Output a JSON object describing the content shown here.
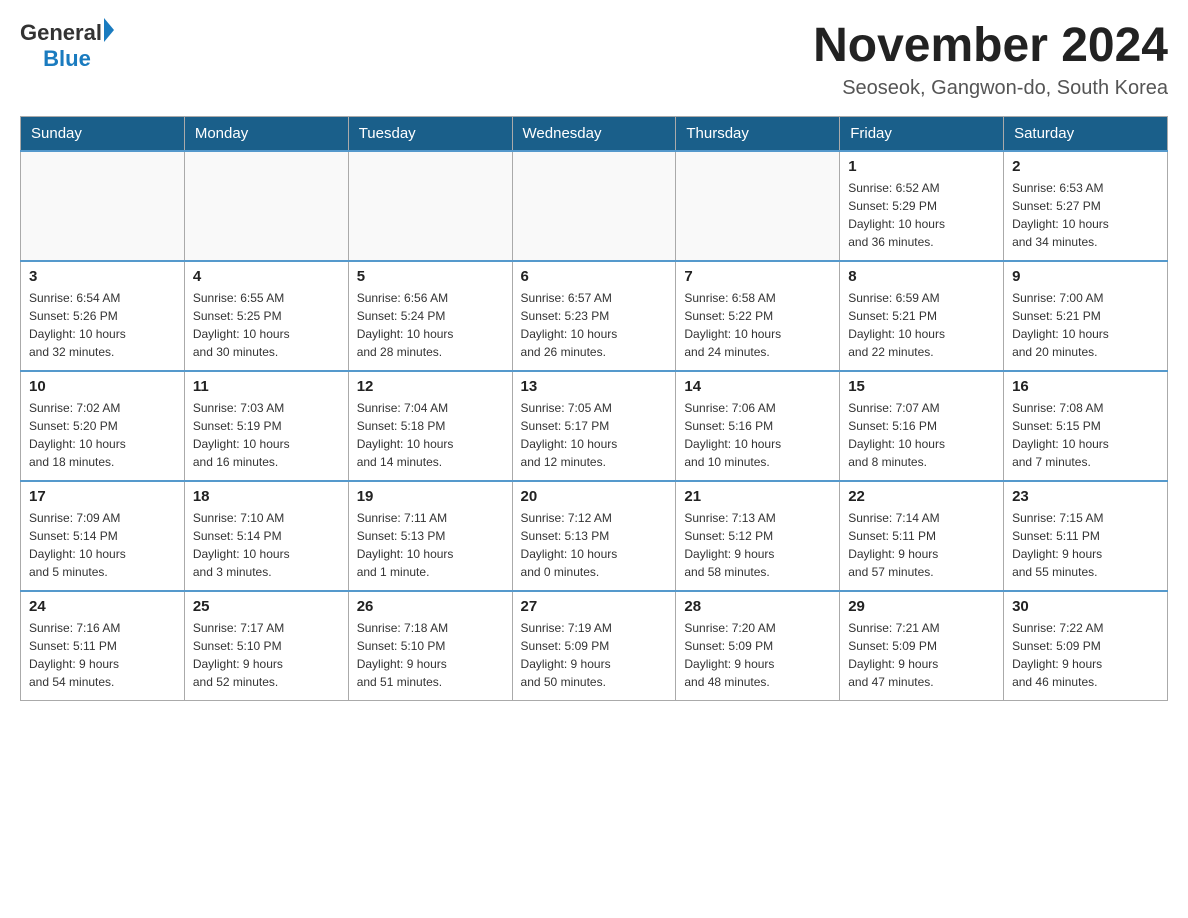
{
  "header": {
    "logo_general": "General",
    "logo_blue": "Blue",
    "month_year": "November 2024",
    "location": "Seoseok, Gangwon-do, South Korea"
  },
  "weekdays": [
    "Sunday",
    "Monday",
    "Tuesday",
    "Wednesday",
    "Thursday",
    "Friday",
    "Saturday"
  ],
  "weeks": [
    [
      {
        "day": "",
        "info": ""
      },
      {
        "day": "",
        "info": ""
      },
      {
        "day": "",
        "info": ""
      },
      {
        "day": "",
        "info": ""
      },
      {
        "day": "",
        "info": ""
      },
      {
        "day": "1",
        "info": "Sunrise: 6:52 AM\nSunset: 5:29 PM\nDaylight: 10 hours\nand 36 minutes."
      },
      {
        "day": "2",
        "info": "Sunrise: 6:53 AM\nSunset: 5:27 PM\nDaylight: 10 hours\nand 34 minutes."
      }
    ],
    [
      {
        "day": "3",
        "info": "Sunrise: 6:54 AM\nSunset: 5:26 PM\nDaylight: 10 hours\nand 32 minutes."
      },
      {
        "day": "4",
        "info": "Sunrise: 6:55 AM\nSunset: 5:25 PM\nDaylight: 10 hours\nand 30 minutes."
      },
      {
        "day": "5",
        "info": "Sunrise: 6:56 AM\nSunset: 5:24 PM\nDaylight: 10 hours\nand 28 minutes."
      },
      {
        "day": "6",
        "info": "Sunrise: 6:57 AM\nSunset: 5:23 PM\nDaylight: 10 hours\nand 26 minutes."
      },
      {
        "day": "7",
        "info": "Sunrise: 6:58 AM\nSunset: 5:22 PM\nDaylight: 10 hours\nand 24 minutes."
      },
      {
        "day": "8",
        "info": "Sunrise: 6:59 AM\nSunset: 5:21 PM\nDaylight: 10 hours\nand 22 minutes."
      },
      {
        "day": "9",
        "info": "Sunrise: 7:00 AM\nSunset: 5:21 PM\nDaylight: 10 hours\nand 20 minutes."
      }
    ],
    [
      {
        "day": "10",
        "info": "Sunrise: 7:02 AM\nSunset: 5:20 PM\nDaylight: 10 hours\nand 18 minutes."
      },
      {
        "day": "11",
        "info": "Sunrise: 7:03 AM\nSunset: 5:19 PM\nDaylight: 10 hours\nand 16 minutes."
      },
      {
        "day": "12",
        "info": "Sunrise: 7:04 AM\nSunset: 5:18 PM\nDaylight: 10 hours\nand 14 minutes."
      },
      {
        "day": "13",
        "info": "Sunrise: 7:05 AM\nSunset: 5:17 PM\nDaylight: 10 hours\nand 12 minutes."
      },
      {
        "day": "14",
        "info": "Sunrise: 7:06 AM\nSunset: 5:16 PM\nDaylight: 10 hours\nand 10 minutes."
      },
      {
        "day": "15",
        "info": "Sunrise: 7:07 AM\nSunset: 5:16 PM\nDaylight: 10 hours\nand 8 minutes."
      },
      {
        "day": "16",
        "info": "Sunrise: 7:08 AM\nSunset: 5:15 PM\nDaylight: 10 hours\nand 7 minutes."
      }
    ],
    [
      {
        "day": "17",
        "info": "Sunrise: 7:09 AM\nSunset: 5:14 PM\nDaylight: 10 hours\nand 5 minutes."
      },
      {
        "day": "18",
        "info": "Sunrise: 7:10 AM\nSunset: 5:14 PM\nDaylight: 10 hours\nand 3 minutes."
      },
      {
        "day": "19",
        "info": "Sunrise: 7:11 AM\nSunset: 5:13 PM\nDaylight: 10 hours\nand 1 minute."
      },
      {
        "day": "20",
        "info": "Sunrise: 7:12 AM\nSunset: 5:13 PM\nDaylight: 10 hours\nand 0 minutes."
      },
      {
        "day": "21",
        "info": "Sunrise: 7:13 AM\nSunset: 5:12 PM\nDaylight: 9 hours\nand 58 minutes."
      },
      {
        "day": "22",
        "info": "Sunrise: 7:14 AM\nSunset: 5:11 PM\nDaylight: 9 hours\nand 57 minutes."
      },
      {
        "day": "23",
        "info": "Sunrise: 7:15 AM\nSunset: 5:11 PM\nDaylight: 9 hours\nand 55 minutes."
      }
    ],
    [
      {
        "day": "24",
        "info": "Sunrise: 7:16 AM\nSunset: 5:11 PM\nDaylight: 9 hours\nand 54 minutes."
      },
      {
        "day": "25",
        "info": "Sunrise: 7:17 AM\nSunset: 5:10 PM\nDaylight: 9 hours\nand 52 minutes."
      },
      {
        "day": "26",
        "info": "Sunrise: 7:18 AM\nSunset: 5:10 PM\nDaylight: 9 hours\nand 51 minutes."
      },
      {
        "day": "27",
        "info": "Sunrise: 7:19 AM\nSunset: 5:09 PM\nDaylight: 9 hours\nand 50 minutes."
      },
      {
        "day": "28",
        "info": "Sunrise: 7:20 AM\nSunset: 5:09 PM\nDaylight: 9 hours\nand 48 minutes."
      },
      {
        "day": "29",
        "info": "Sunrise: 7:21 AM\nSunset: 5:09 PM\nDaylight: 9 hours\nand 47 minutes."
      },
      {
        "day": "30",
        "info": "Sunrise: 7:22 AM\nSunset: 5:09 PM\nDaylight: 9 hours\nand 46 minutes."
      }
    ]
  ]
}
